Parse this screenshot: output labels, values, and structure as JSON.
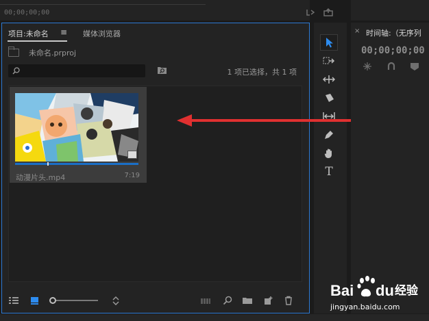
{
  "top": {
    "source_timecode": "00;00;00;00"
  },
  "project_panel": {
    "tab_project": "项目:未命名",
    "tab_menu_symbol": "≡",
    "tab_media_browser": "媒体浏览器",
    "project_file": "未命名.prproj",
    "search": {
      "placeholder": "",
      "value": ""
    },
    "selection_info": "1 项已选择，共 1 项",
    "items": [
      {
        "name": "动漫片头.mp4",
        "duration": "7:19"
      }
    ],
    "bottom_icons": [
      "list-view-icon",
      "icon-view-icon",
      "zoom-slider",
      "sort-icon",
      "automate-sequence-icon",
      "find-icon",
      "new-bin-icon",
      "new-item-icon",
      "clear-icon"
    ]
  },
  "tools": [
    {
      "name": "selection-tool-icon",
      "active": true
    },
    {
      "name": "track-select-tool-icon"
    },
    {
      "name": "ripple-edit-tool-icon"
    },
    {
      "name": "razor-tool-icon"
    },
    {
      "name": "slip-tool-icon"
    },
    {
      "name": "pen-tool-icon"
    },
    {
      "name": "hand-tool-icon"
    },
    {
      "name": "type-tool-icon",
      "glyph": "T"
    }
  ],
  "timeline_panel": {
    "close_symbol": "×",
    "title": "时间轴:（无序列",
    "timecode": "00;00;00;00"
  },
  "watermark": {
    "url": "jingyan.baidu.com"
  },
  "colors": {
    "panel_bg": "#232323",
    "app_bg": "#1b1b1b",
    "accent_blue": "#2d7bd6",
    "annotation_red": "#e03030"
  }
}
